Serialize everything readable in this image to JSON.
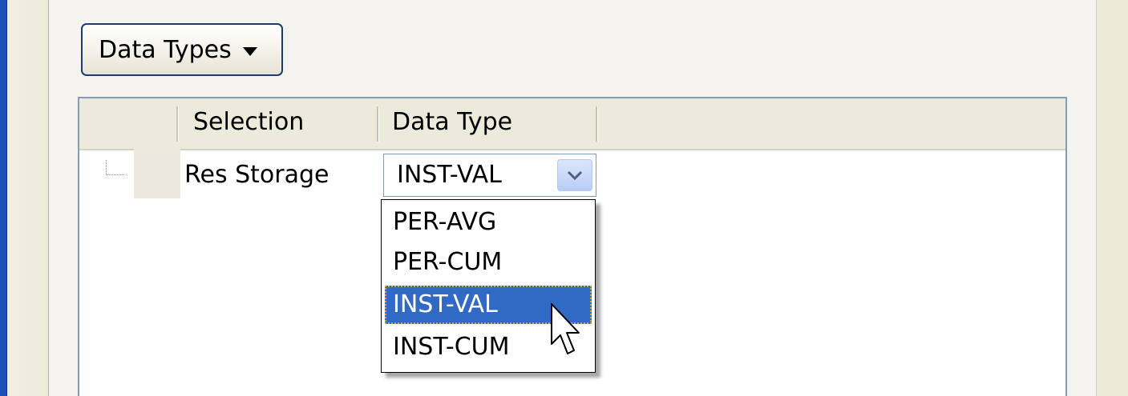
{
  "toolbar": {
    "data_types_button": "Data Types"
  },
  "grid": {
    "columns": [
      "Selection",
      "Data Type"
    ],
    "rows": [
      {
        "selection": "Res Storage",
        "data_type": "INST-VAL"
      }
    ]
  },
  "dropdown": {
    "options": [
      "PER-AVG",
      "PER-CUM",
      "INST-VAL",
      "INST-CUM"
    ],
    "selected": "INST-VAL"
  },
  "colors": {
    "highlight": "#316ac5",
    "grid_border": "#7f9db9",
    "header_bg": "#ebeadb"
  },
  "icons": [
    "dropdown-arrow-icon",
    "combo-chevron-icon",
    "mouse-cursor-icon",
    "tree-connector-icon"
  ]
}
